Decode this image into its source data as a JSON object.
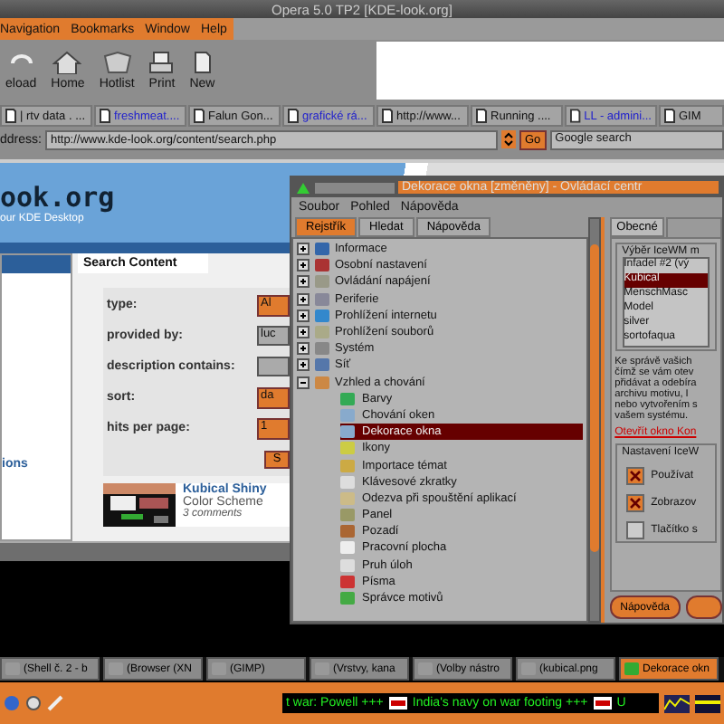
{
  "browser": {
    "title": "Opera 5.0 TP2 [KDE-look.org]",
    "menu": [
      "Navigation",
      "Bookmarks",
      "Window",
      "Help"
    ],
    "toolbar": [
      {
        "label": "eload",
        "kind": "reload"
      },
      {
        "label": "Home",
        "kind": "home"
      },
      {
        "label": "Hotlist",
        "kind": "hotlist"
      },
      {
        "label": "Print",
        "kind": "print"
      },
      {
        "label": "New",
        "kind": "new"
      }
    ],
    "tabs": [
      {
        "label": "| rtv data . ...",
        "link": false
      },
      {
        "label": "freshmeat....",
        "link": true
      },
      {
        "label": "Falun Gon...",
        "link": false
      },
      {
        "label": "grafické rá...",
        "link": true
      },
      {
        "label": "http://www...",
        "link": false
      },
      {
        "label": "Running ....",
        "link": false
      },
      {
        "label": "LL - admini...",
        "link": true
      },
      {
        "label": "GIM",
        "link": false
      }
    ],
    "address": {
      "label": "ddress:",
      "value": "http://www.kde-look.org/content/search.php",
      "go": "Go",
      "search": "Google search"
    },
    "page": {
      "logo": "ook.org",
      "tagline": "our KDE Desktop",
      "panel_title": "Search Content",
      "fields": [
        {
          "label": "type:",
          "value": "Al",
          "kind": "select"
        },
        {
          "label": "provided by:",
          "value": "luc",
          "kind": "input"
        },
        {
          "label": "description contains:",
          "kind": "input"
        },
        {
          "label": "sort:",
          "value": "da",
          "kind": "select"
        },
        {
          "label": "hits per page:",
          "value": "1",
          "kind": "select"
        }
      ],
      "submit": "S",
      "side_link": "ions",
      "result": {
        "title": "Kubical Shiny",
        "subtitle": "Color Scheme",
        "comments": "3 comments"
      }
    }
  },
  "control_center": {
    "title": "Dekorace okna [změněny] - Ovládací centr",
    "menu": [
      "Soubor",
      "Pohled",
      "Nápověda"
    ],
    "tabs": [
      {
        "label": "Rejstřík",
        "selected": true
      },
      {
        "label": "Hledat",
        "selected": false
      },
      {
        "label": "Nápověda",
        "selected": false
      }
    ],
    "tree": [
      {
        "label": "Informace",
        "expanded": false
      },
      {
        "label": "Osobní nastavení",
        "expanded": false
      },
      {
        "label": "Ovládání napájení",
        "expanded": false
      },
      {
        "label": "Periferie",
        "expanded": false
      },
      {
        "label": "Prohlížení internetu",
        "expanded": false
      },
      {
        "label": "Prohlížení souborů",
        "expanded": false
      },
      {
        "label": "Systém",
        "expanded": false
      },
      {
        "label": "Síť",
        "expanded": false
      },
      {
        "label": "Vzhled a chování",
        "expanded": true,
        "children": [
          {
            "label": "Barvy",
            "selected": false
          },
          {
            "label": "Chování oken",
            "selected": false
          },
          {
            "label": "Dekorace okna",
            "selected": true
          },
          {
            "label": "Ikony",
            "selected": false
          },
          {
            "label": "Importace témat",
            "selected": false
          },
          {
            "label": "Klávesové zkratky",
            "selected": false
          },
          {
            "label": "Odezva při spouštění aplikací",
            "selected": false
          },
          {
            "label": "Panel",
            "selected": false
          },
          {
            "label": "Pozadí",
            "selected": false
          },
          {
            "label": "Pracovní plocha",
            "selected": false
          },
          {
            "label": "Pruh úloh",
            "selected": false
          },
          {
            "label": "Písma",
            "selected": false
          },
          {
            "label": "Správce motivů",
            "selected": false
          }
        ]
      }
    ],
    "settings": {
      "tabs": [
        {
          "label": "Obecné",
          "selected": true
        }
      ],
      "theme_group": "Výběr IceWM m",
      "themes": [
        {
          "label": "Infadel #2 (vý",
          "selected": false
        },
        {
          "label": "Kubical",
          "selected": true
        },
        {
          "label": "MenschMasc",
          "selected": false
        },
        {
          "label": "Model",
          "selected": false
        },
        {
          "label": "silver",
          "selected": false
        },
        {
          "label": "sortofaqua",
          "selected": false
        }
      ],
      "description": [
        "Ke správě vašich",
        "čímž se vám otev",
        "přidávat a odebíra",
        "archivu motivu, I",
        "nebo vytvořením s",
        "vašem systému."
      ],
      "link": "Otevřít okno Kon",
      "options_group": "Nastavení IceW",
      "options": [
        {
          "label": "Používat",
          "checked": true
        },
        {
          "label": "Zobrazov",
          "checked": true
        },
        {
          "label": "Tlačítko s",
          "checked": false
        }
      ],
      "buttons": [
        "Nápověda"
      ]
    }
  },
  "taskbar": {
    "tasks": [
      {
        "label": "(Shell č. 2 - b",
        "selected": false
      },
      {
        "label": "(Browser (XN",
        "selected": false
      },
      {
        "label": "(GIMP)",
        "selected": false
      },
      {
        "label": "(Vrstvy, kana",
        "selected": false
      },
      {
        "label": "(Volby nástro",
        "selected": false
      },
      {
        "label": "(kubical.png",
        "selected": false
      },
      {
        "label": "Dekorace okn",
        "selected": true
      }
    ],
    "ticker": [
      "t war: Powell +++",
      "India's navy on war footing +++",
      "U"
    ]
  }
}
